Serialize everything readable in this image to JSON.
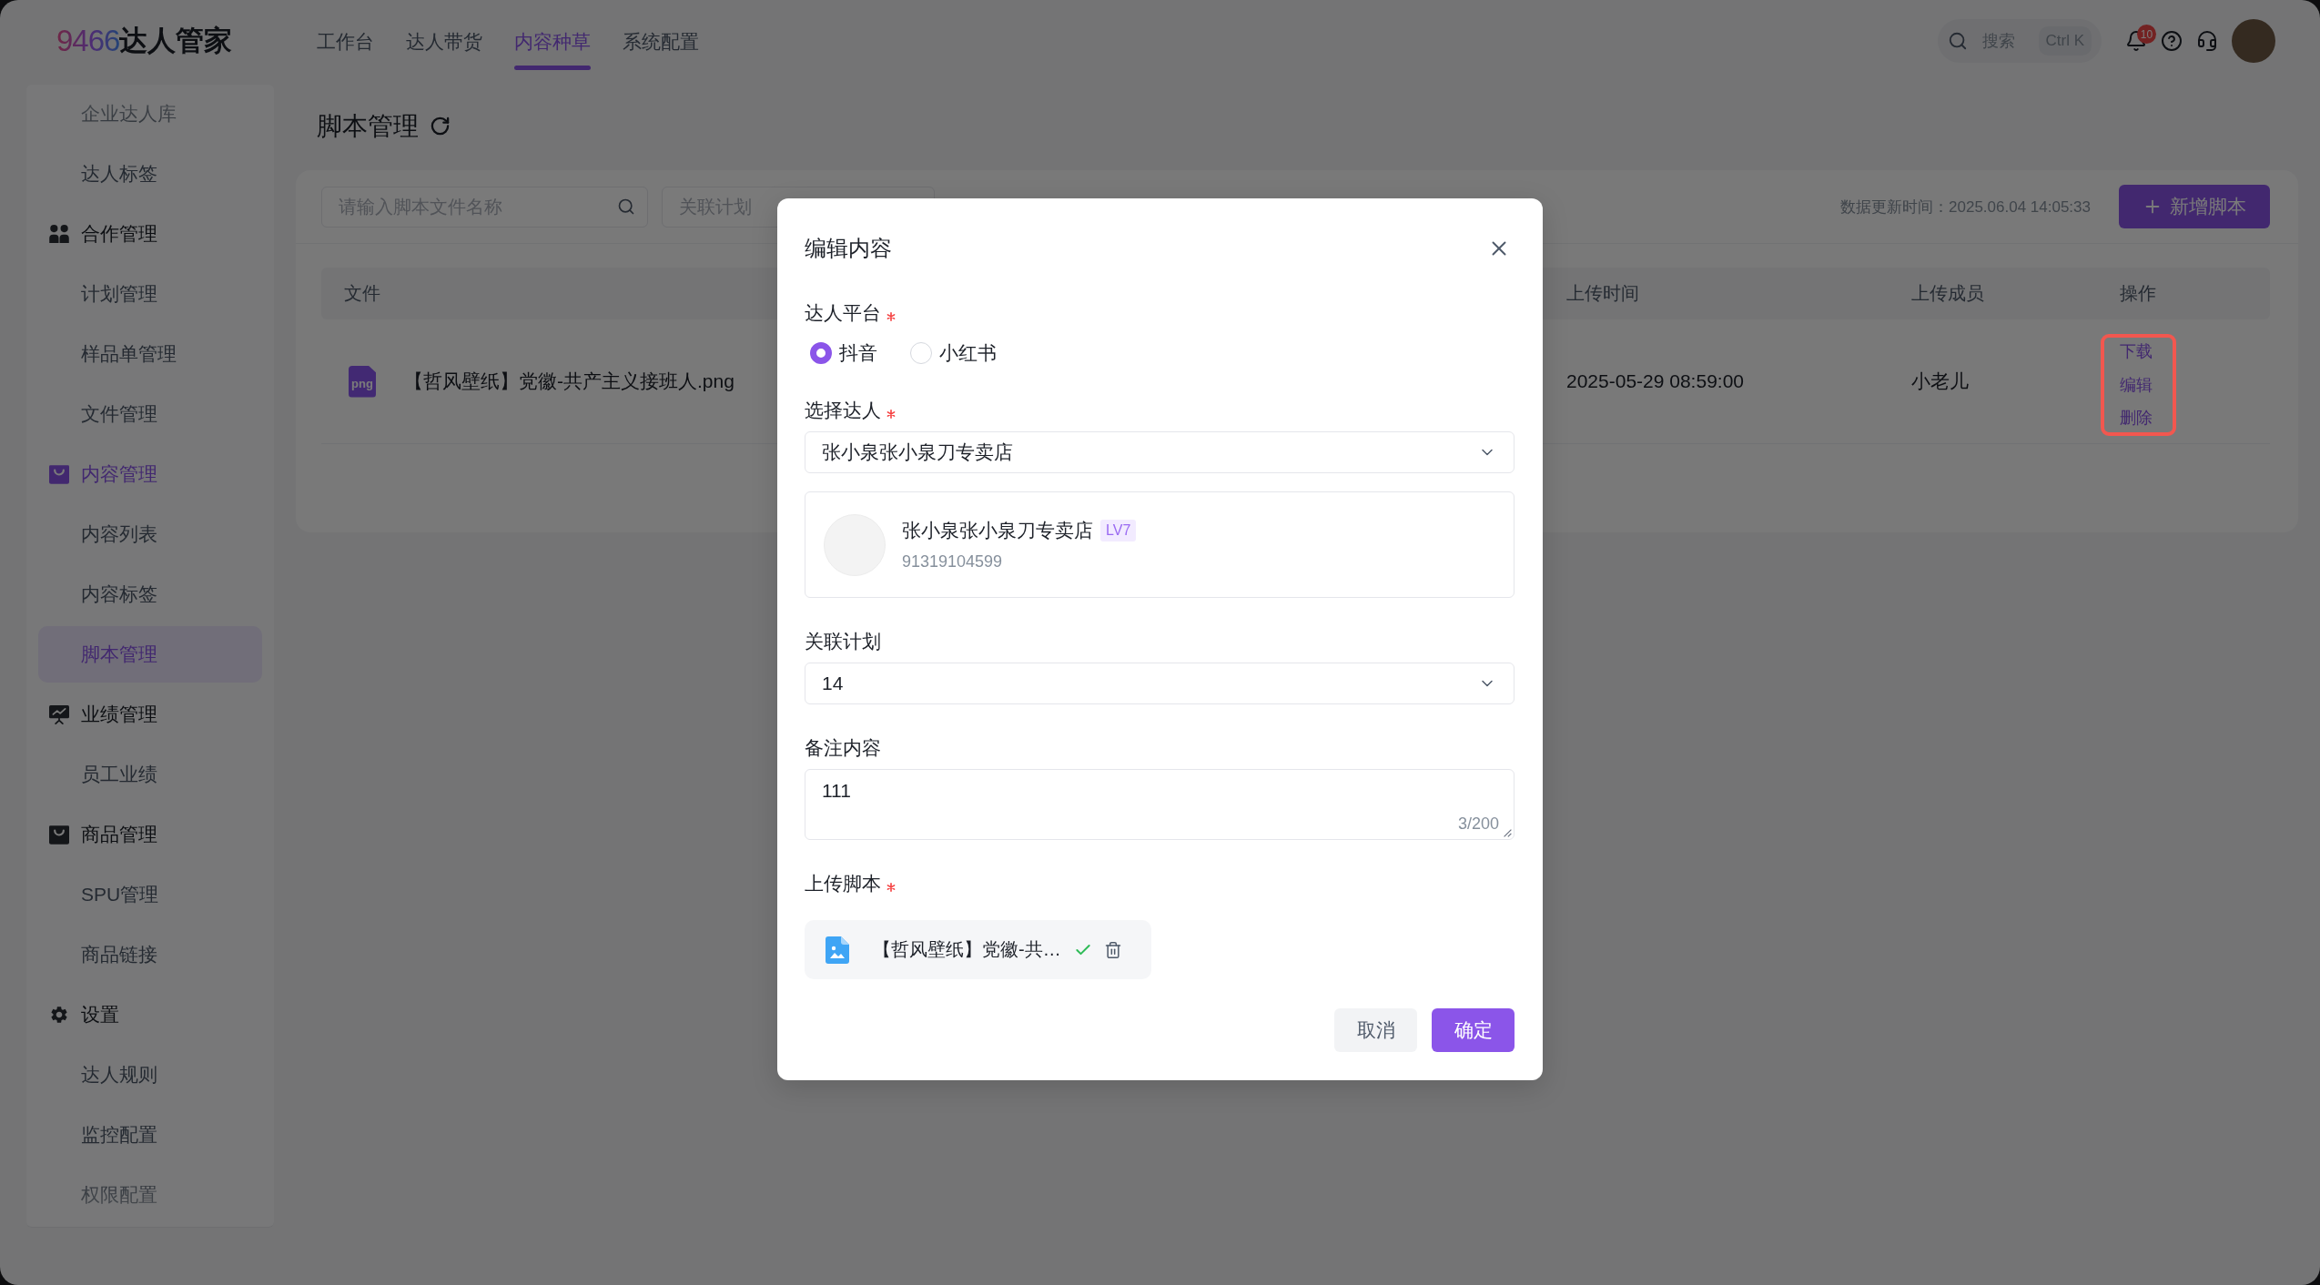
{
  "header": {
    "logo": {
      "mark": "9466",
      "name": "达人管家"
    },
    "nav": [
      {
        "label": "工作台",
        "selected": false
      },
      {
        "label": "达人带货",
        "selected": false
      },
      {
        "label": "内容种草",
        "selected": true
      },
      {
        "label": "系统配置",
        "selected": false
      }
    ],
    "search": {
      "placeholder": "搜索",
      "shortcut": "Ctrl K"
    },
    "notifications": {
      "badge": "10"
    }
  },
  "sidebar": {
    "items": [
      {
        "label": "企业达人库",
        "selected": false
      },
      {
        "label": "达人标签",
        "selected": false
      },
      {
        "label": "合作管理",
        "children": [
          {
            "label": "计划管理",
            "selected": false
          },
          {
            "label": "样品单管理",
            "selected": false
          },
          {
            "label": "文件管理",
            "selected": false
          }
        ]
      },
      {
        "label": "内容管理",
        "children": [
          {
            "label": "内容列表",
            "selected": false
          },
          {
            "label": "内容标签",
            "selected": false
          },
          {
            "label": "脚本管理",
            "selected": true
          }
        ]
      },
      {
        "label": "业绩管理",
        "children": [
          {
            "label": "员工业绩",
            "selected": false
          }
        ]
      },
      {
        "label": "商品管理",
        "children": [
          {
            "label": "SPU管理",
            "selected": false
          },
          {
            "label": "商品链接",
            "selected": false
          }
        ]
      },
      {
        "label": "设置",
        "children": [
          {
            "label": "达人规则",
            "selected": false
          },
          {
            "label": "监控配置",
            "selected": false
          },
          {
            "label": "权限配置",
            "selected": false
          }
        ]
      }
    ]
  },
  "page": {
    "title": "脚本管理"
  },
  "toolbar": {
    "search": {
      "placeholder": "请输入脚本文件名称"
    },
    "plan_filter": {
      "placeholder": "关联计划"
    },
    "updated": "数据更新时间：2025.06.04 14:05:33",
    "add_button": "新增脚本"
  },
  "table": {
    "columns": [
      "文件",
      "上传时间",
      "上传成员",
      "操作"
    ],
    "rows": [
      {
        "file_type": "png",
        "file": "【哲风壁纸】党徽-共产主义接班人.png",
        "uploaded_at": "2025-05-29 08:59:00",
        "uploader": "小老儿",
        "actions": [
          "下载",
          "编辑",
          "删除"
        ],
        "actions_highlighted": true
      }
    ]
  },
  "dialog": {
    "title": "编辑内容",
    "fields": [
      {
        "kind": "radio",
        "label": "达人平台",
        "required": true,
        "options": [
          {
            "label": "抖音",
            "selected": true
          },
          {
            "label": "小红书",
            "selected": false
          }
        ]
      },
      {
        "kind": "select",
        "label": "选择达人",
        "required": true,
        "value": "张小泉张小泉刀专卖店",
        "card": {
          "name": "张小泉张小泉刀专卖店",
          "grade": "LV7",
          "id": "91319104599"
        }
      },
      {
        "kind": "select",
        "label": "关联计划",
        "value": "14"
      },
      {
        "kind": "textarea",
        "label": "备注内容",
        "value": "111",
        "count": "3/200"
      },
      {
        "kind": "upload",
        "label": "上传脚本",
        "required": true,
        "files": [
          {
            "name": "【哲风壁纸】党徽-共…",
            "uploaded": true
          }
        ]
      }
    ],
    "buttons": [
      {
        "label": "取消",
        "kind": "secondary"
      },
      {
        "label": "确定",
        "kind": "primary"
      }
    ]
  }
}
